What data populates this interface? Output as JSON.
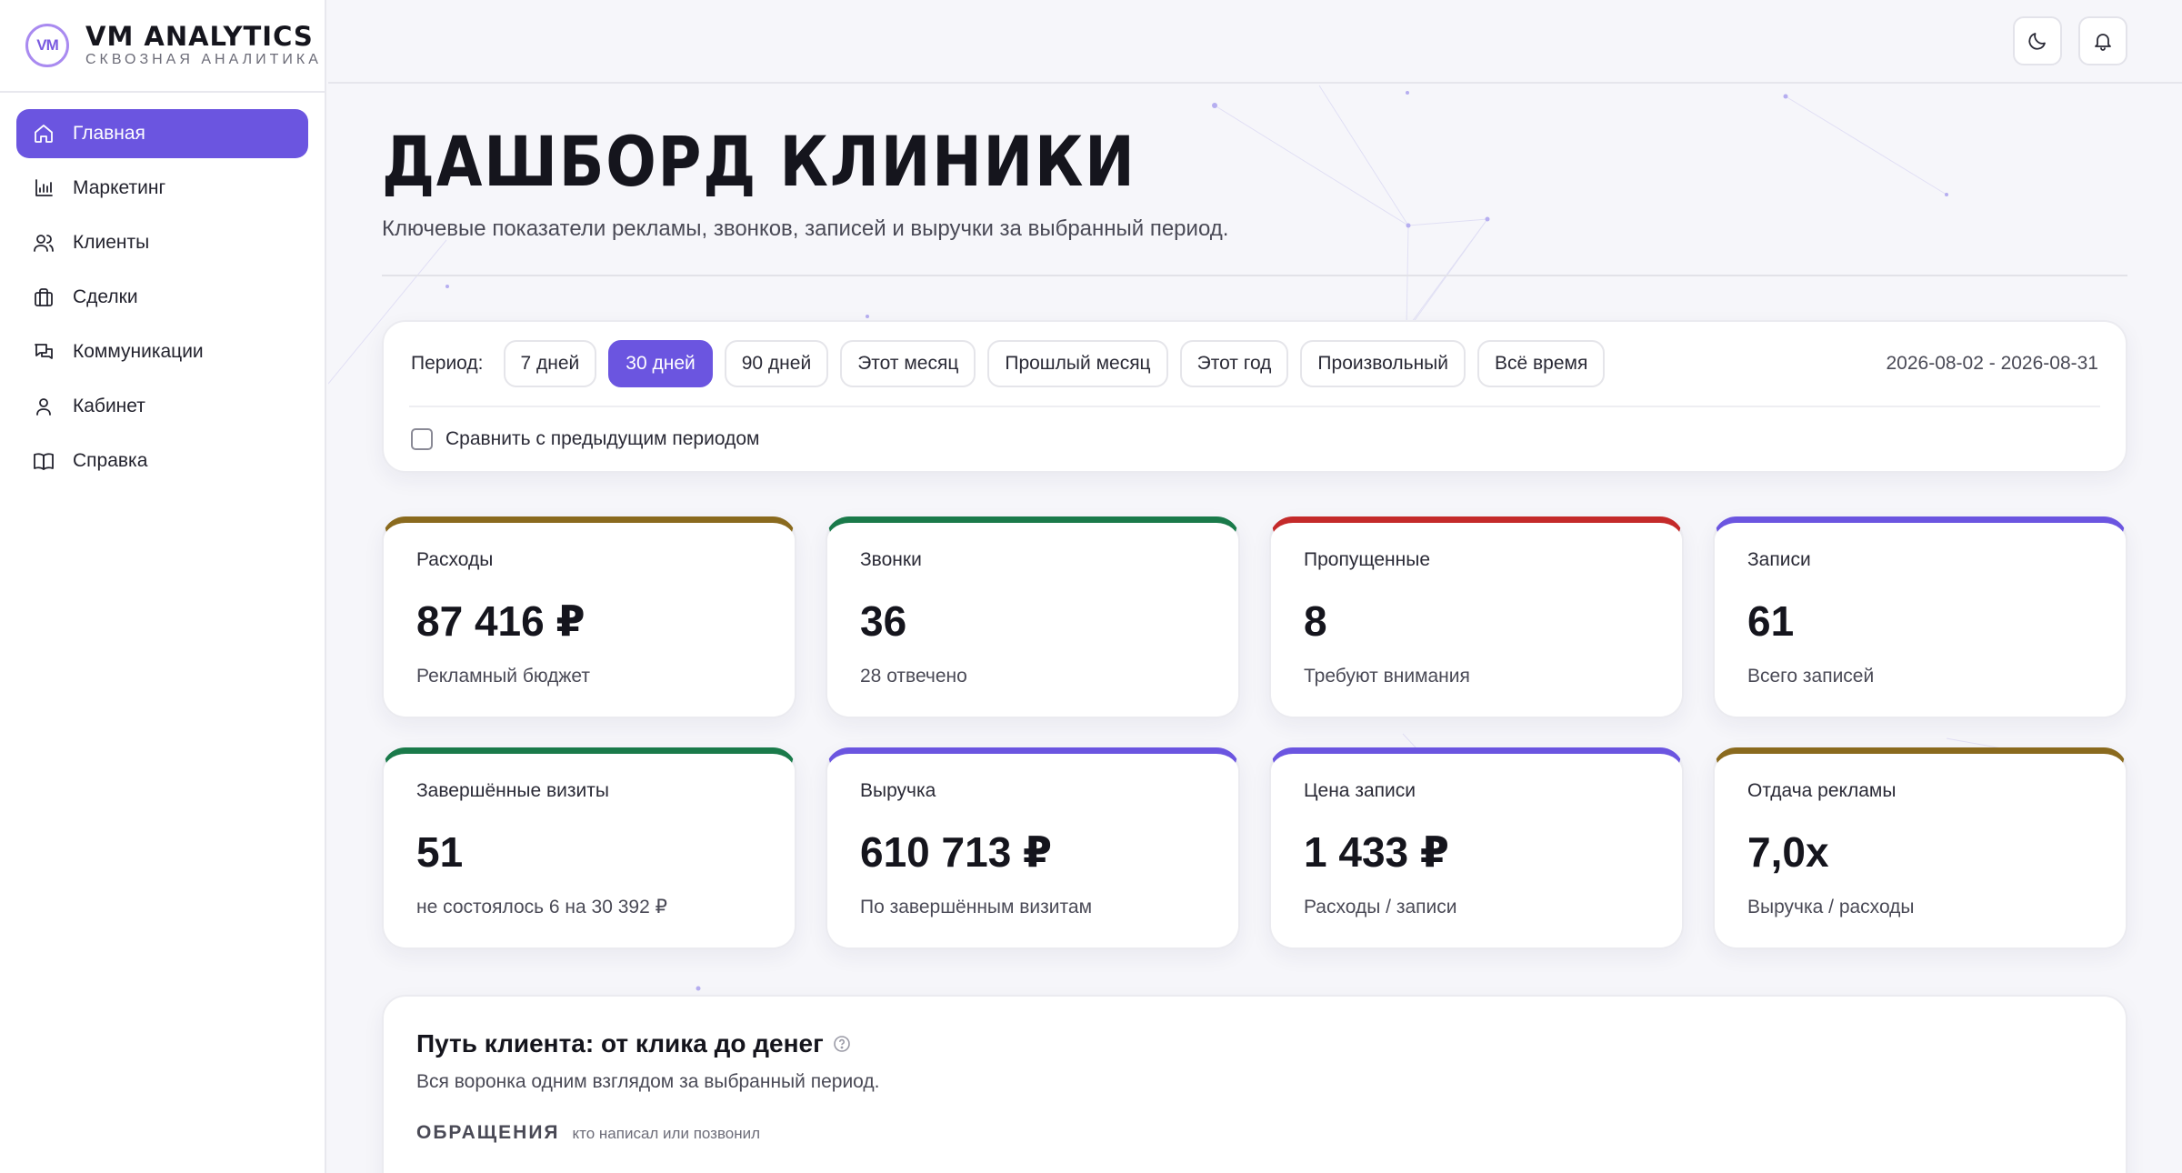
{
  "brand": {
    "logo_text": "VM",
    "name": "VM ANALYTICS",
    "subtitle": "СКВОЗНАЯ АНАЛИТИКА"
  },
  "sidebar": {
    "items": [
      {
        "label": "Главная",
        "icon": "home-icon",
        "active": true
      },
      {
        "label": "Маркетинг",
        "icon": "bar-chart-icon",
        "active": false
      },
      {
        "label": "Клиенты",
        "icon": "users-icon",
        "active": false
      },
      {
        "label": "Сделки",
        "icon": "briefcase-icon",
        "active": false
      },
      {
        "label": "Коммуникации",
        "icon": "chat-icon",
        "active": false
      },
      {
        "label": "Кабинет",
        "icon": "user-icon",
        "active": false
      },
      {
        "label": "Справка",
        "icon": "book-icon",
        "active": false
      }
    ]
  },
  "topbar": {
    "theme_icon": "moon-icon",
    "notifications_icon": "bell-icon"
  },
  "header": {
    "title": "ДАШБОРД КЛИНИКИ",
    "subtitle": "Ключевые показатели рекламы, звонков, записей и выручки за выбранный период."
  },
  "period": {
    "label": "Период:",
    "options": [
      "7 дней",
      "30 дней",
      "90 дней",
      "Этот месяц",
      "Прошлый месяц",
      "Этот год",
      "Произвольный",
      "Всё время"
    ],
    "selected": "30 дней",
    "range": "2026-08-02 - 2026-08-31",
    "compare_label": "Сравнить с предыдущим периодом",
    "compare_checked": false
  },
  "kpis": [
    {
      "label": "Расходы",
      "value": "87 416 ₽",
      "note": "Рекламный бюджет",
      "accent": "#8a6a1e"
    },
    {
      "label": "Звонки",
      "value": "36",
      "note": "28 отвечено",
      "accent": "#1a7a4a"
    },
    {
      "label": "Пропущенные",
      "value": "8",
      "note": "Требуют внимания",
      "accent": "#c42a2a"
    },
    {
      "label": "Записи",
      "value": "61",
      "note": "Всего записей",
      "accent": "#6b55e0"
    },
    {
      "label": "Завершённые визиты",
      "value": "51",
      "note": "не состоялось 6 на 30 392 ₽",
      "accent": "#1a7a4a"
    },
    {
      "label": "Выручка",
      "value": "610 713 ₽",
      "note": "По завершённым визитам",
      "accent": "#6b55e0"
    },
    {
      "label": "Цена записи",
      "value": "1 433 ₽",
      "note": "Расходы / записи",
      "accent": "#6b55e0"
    },
    {
      "label": "Отдача рекламы",
      "value": "7,0x",
      "note": "Выручка / расходы",
      "accent": "#8a6a1e"
    }
  ],
  "journey": {
    "title": "Путь клиента: от клика до денег",
    "help_icon": "help-circle-icon",
    "subtitle": "Вся воронка одним взглядом за выбранный период.",
    "section_title": "ОБРАЩЕНИЯ",
    "section_hint": "кто написал или позвонил"
  },
  "colors": {
    "accent": "#6b55e0",
    "background": "#f6f6fa"
  }
}
